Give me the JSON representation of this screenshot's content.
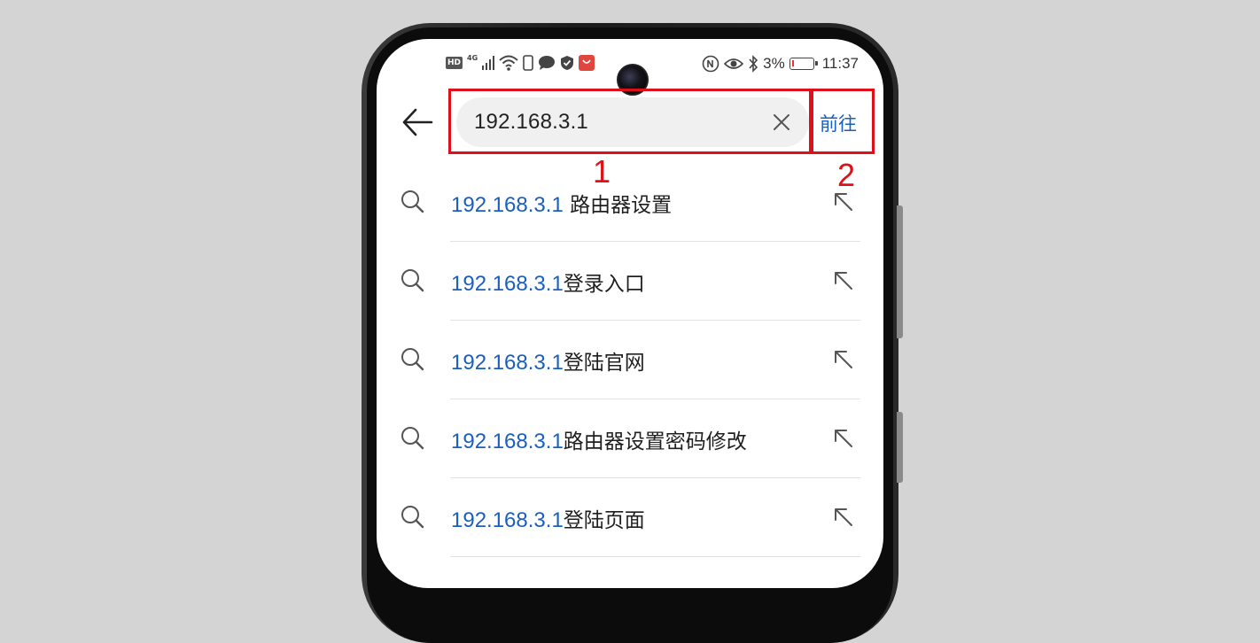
{
  "status_bar": {
    "left_icons": [
      "hd-icon",
      "4g-signal-icon",
      "wifi-icon",
      "phone-icon",
      "message-icon",
      "shield-icon",
      "huawei-store-icon"
    ],
    "hd_label": "HD",
    "network_label": "4G",
    "right_icons": [
      "nfc-icon",
      "eye-comfort-icon",
      "bluetooth-icon",
      "battery-icon"
    ],
    "battery_percent": "3%",
    "time": "11:37"
  },
  "search": {
    "value": "192.168.3.1",
    "go_label": "前往"
  },
  "annotations": {
    "box1_number": "1",
    "box2_number": "2",
    "color": "#e0101a"
  },
  "suggestions": [
    {
      "ip": "192.168.3.1",
      "text": " 路由器设置"
    },
    {
      "ip": "192.168.3.1",
      "text": "登录入口"
    },
    {
      "ip": "192.168.3.1",
      "text": "登陆官网"
    },
    {
      "ip": "192.168.3.1",
      "text": "路由器设置密码修改"
    },
    {
      "ip": "192.168.3.1",
      "text": "登陆页面"
    }
  ],
  "colors": {
    "accent": "#1a5fbf",
    "background": "#d4d4d4"
  }
}
